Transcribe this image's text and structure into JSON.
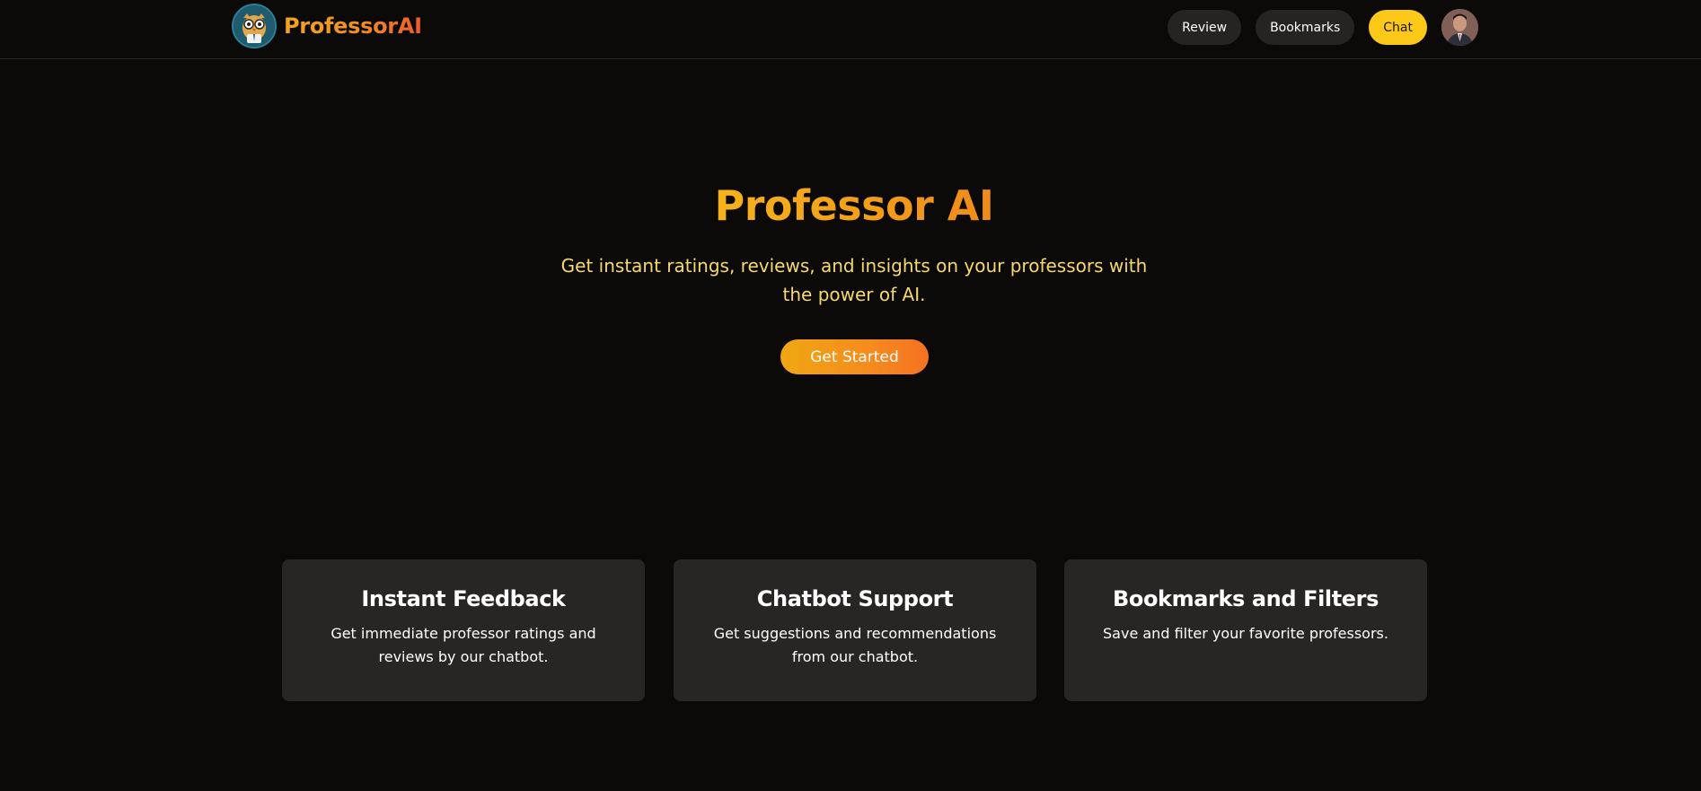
{
  "header": {
    "brand": "ProfessorAI",
    "logo_icon": "owl-professor-icon",
    "nav": [
      {
        "label": "Review",
        "active": false
      },
      {
        "label": "Bookmarks",
        "active": false
      },
      {
        "label": "Chat",
        "active": true
      }
    ],
    "avatar_icon": "user-avatar"
  },
  "hero": {
    "title": "Professor AI",
    "subtitle": "Get instant ratings, reviews, and insights on your professors with the power of AI.",
    "cta": "Get Started"
  },
  "features": [
    {
      "title": "Instant Feedback",
      "description": "Get immediate professor ratings and reviews by our chatbot."
    },
    {
      "title": "Chatbot Support",
      "description": "Get suggestions and recommendations from our chatbot."
    },
    {
      "title": "Bookmarks and Filters",
      "description": "Save and filter your favorite professors."
    }
  ],
  "colors": {
    "background": "#0b0a09",
    "accent_yellow": "#fcc918",
    "accent_orange": "#f58b1d",
    "card": "#282625",
    "pill": "#262423",
    "subtitle": "#f7d96b"
  }
}
